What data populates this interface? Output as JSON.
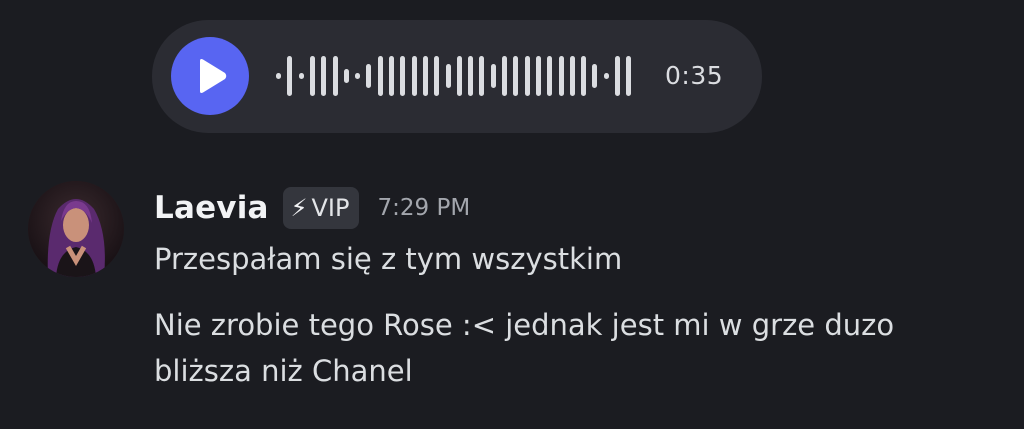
{
  "voice_message": {
    "play_icon": "play-icon",
    "duration": "0:35",
    "accent_color": "#5865f2"
  },
  "message": {
    "avatar_icon": "avatar",
    "username": "Laevia",
    "badge": {
      "icon": "⚡",
      "label": "VIP"
    },
    "timestamp": "7:29 PM",
    "lines": [
      "Przespałam się z tym wszystkim",
      "Nie zrobie tego Rose :< jednak jest mi w grze duzo",
      "bliższa niż Chanel"
    ]
  }
}
